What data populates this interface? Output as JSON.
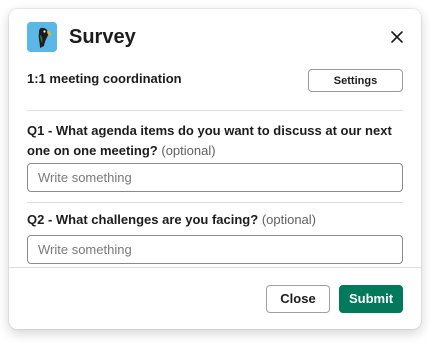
{
  "modal": {
    "title": "Survey",
    "app_icon": "parrot-app-icon",
    "close_icon": "close-icon"
  },
  "meeting": {
    "label": "1:1 meeting coordination",
    "settings_label": "Settings"
  },
  "questions": [
    {
      "prefix": "Q1 - ",
      "text": "What agenda items do you want to discuss at our next one on one meeting?",
      "optional_label": "(optional)",
      "placeholder": "Write something",
      "value": ""
    },
    {
      "prefix": "Q2 - ",
      "text": "What challenges are you facing?",
      "optional_label": "(optional)",
      "placeholder": "Write something",
      "value": ""
    }
  ],
  "footer": {
    "close_label": "Close",
    "submit_label": "Submit"
  },
  "colors": {
    "primary": "#007a5a",
    "app_icon_bg": "#5bb8e6"
  }
}
